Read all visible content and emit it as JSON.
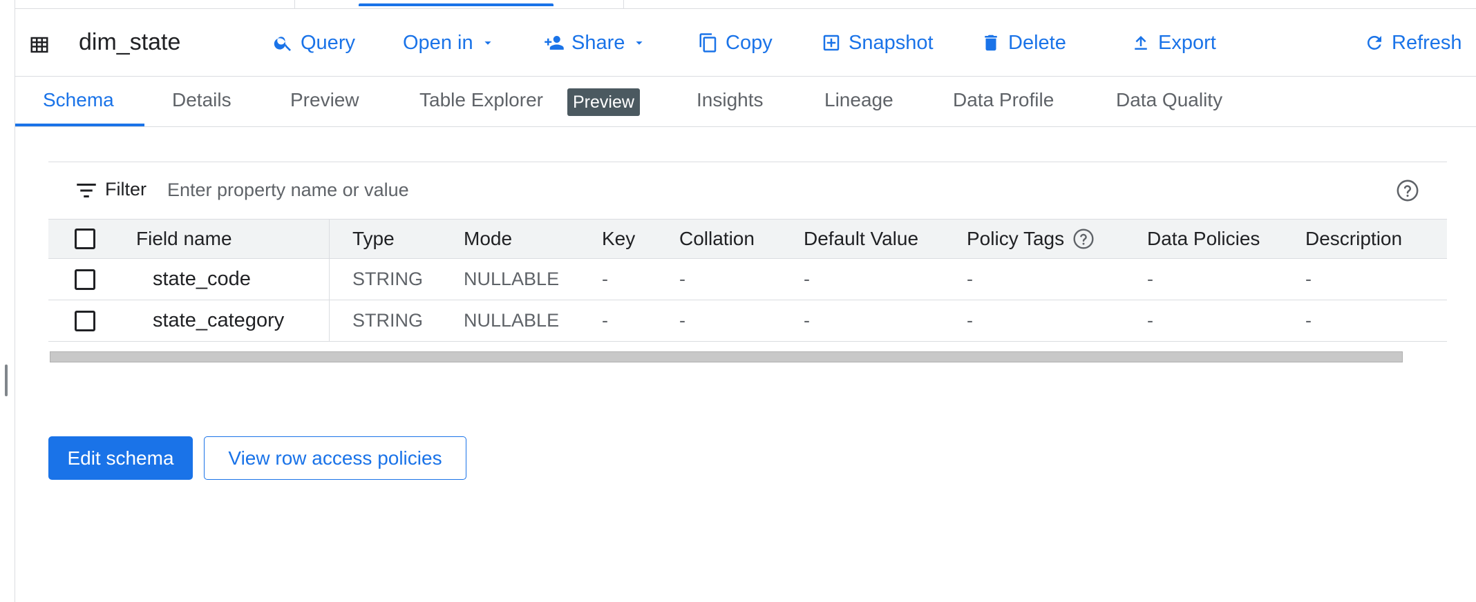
{
  "colors": {
    "accent": "#1a73e8",
    "text": "#202124",
    "muted": "#5f6368",
    "chip": "#4b5960"
  },
  "toolbar": {
    "table_icon": "table-grid-icon",
    "table_name": "dim_state",
    "buttons": [
      {
        "icon": "search-icon",
        "label": "Query"
      },
      {
        "icon": "chevron-down-icon",
        "label": "Open in"
      },
      {
        "icon": "person-add-icon",
        "label": "Share"
      },
      {
        "icon": "copy-icon",
        "label": "Copy"
      },
      {
        "icon": "snapshot-icon",
        "label": "Snapshot"
      },
      {
        "icon": "trash-icon",
        "label": "Delete"
      },
      {
        "icon": "upload-icon",
        "label": "Export"
      },
      {
        "icon": "refresh-icon",
        "label": "Refresh"
      }
    ]
  },
  "tabs": [
    {
      "label": "Schema",
      "active": true
    },
    {
      "label": "Details"
    },
    {
      "label": "Preview"
    },
    {
      "label": "Table Explorer",
      "badge": "Preview"
    },
    {
      "label": "Insights"
    },
    {
      "label": "Lineage"
    },
    {
      "label": "Data Profile"
    },
    {
      "label": "Data Quality"
    }
  ],
  "filter": {
    "label": "Filter",
    "placeholder": "Enter property name or value"
  },
  "schema_table": {
    "columns": [
      "Field name",
      "Type",
      "Mode",
      "Key",
      "Collation",
      "Default Value",
      "Policy Tags",
      "Data Policies",
      "Description"
    ],
    "rows": [
      {
        "field": "state_code",
        "type": "STRING",
        "mode": "NULLABLE",
        "key": "-",
        "collation": "-",
        "default": "-",
        "policy_tags": "-",
        "data_policies": "-",
        "description": "-"
      },
      {
        "field": "state_category",
        "type": "STRING",
        "mode": "NULLABLE",
        "key": "-",
        "collation": "-",
        "default": "-",
        "policy_tags": "-",
        "data_policies": "-",
        "description": "-"
      }
    ]
  },
  "actions": {
    "edit_schema": "Edit schema",
    "view_row_access": "View row access policies"
  }
}
